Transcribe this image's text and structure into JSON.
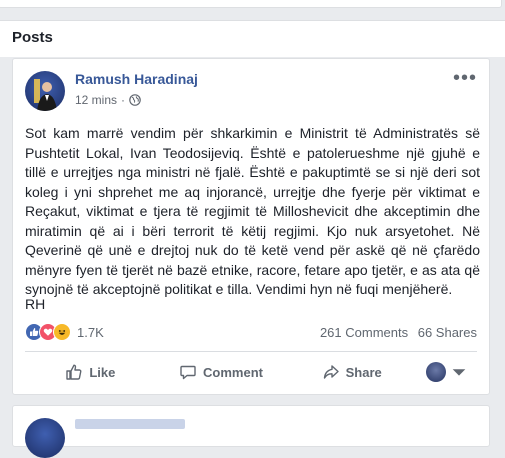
{
  "section": {
    "title": "Posts"
  },
  "post": {
    "author": "Ramush Haradinaj",
    "time": "12 mins",
    "separator": "·",
    "privacy_icon": "globe-icon",
    "more_icon": "more-options-icon",
    "more_glyph": "•••",
    "text": "Sot kam marrë vendim për shkarkimin e Ministrit të Administratës së Pushtetit Lokal, Ivan Teodosijeviq. Është e patolerueshme një gjuhë e tillë e urrejtjes nga ministri në fjalë. Është e pakuptimtë se si një deri sot koleg i yni shprehet me aq injorancë, urrejtje dhe fyerje për viktimat e Reçakut, viktimat e tjera të regjimit të Milloshevicit dhe akceptimin dhe miratimin që ai i bëri terrorit të këtij regjimi. Kjo nuk arsyetohet. Në Qeverinë që unë e drejtoj nuk do të ketë vend për askë që në çfarëdo mënyre fyen të tjerët në bazë etnike, racore, fetare apo tjetër, e as ata që synojnë të akceptojnë politikat e tilla. Vendimi hyn në fuqi menjëherë.",
    "signature": "RH",
    "reactions": {
      "types": [
        "like",
        "love",
        "haha"
      ],
      "count": "1.7K"
    },
    "comments": "261 Comments",
    "shares": "66 Shares",
    "actions": {
      "like": "Like",
      "comment": "Comment",
      "share": "Share"
    },
    "colors": {
      "author": "#385898",
      "like_reaction": "#4267b2",
      "love_reaction": "#f25268",
      "haha_reaction": "#f7b928"
    }
  }
}
